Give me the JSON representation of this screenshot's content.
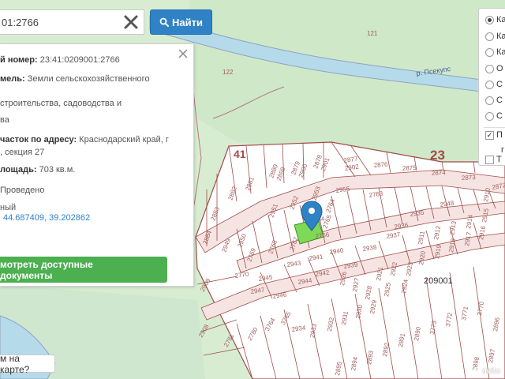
{
  "search": {
    "value": "01:2766",
    "button_label": "Найти",
    "clear_icon": "close-icon",
    "button_icon": "search-icon"
  },
  "info": {
    "lines": [
      {
        "label": "й номер:",
        "value": "23:41:0209001:2766"
      },
      {
        "label": "мель:",
        "value": "Земли сельскохозяйственного"
      },
      {
        "label": "",
        "value": ""
      },
      {
        "label": "",
        "value": "строительства, садоводства и"
      },
      {
        "label": "",
        "value": "ва"
      },
      {
        "label": "",
        "value": ""
      },
      {
        "label": "часток по адресу:",
        "value": "Краснодарский край, г"
      },
      {
        "label": "",
        "value": ", секция 27"
      },
      {
        "label": "",
        "value": ""
      },
      {
        "label": "лощадь:",
        "value": "703 кв.м."
      },
      {
        "label": "",
        "value": ""
      },
      {
        "label": "",
        "value": "Проведено"
      },
      {
        "label": "",
        "value": ""
      },
      {
        "label": "",
        "value": "ный"
      },
      {
        "label": "",
        "value": "44.687409, 39.202862"
      }
    ],
    "docs_button": "мотреть доступные документы"
  },
  "hint": {
    "label": "м на карте?"
  },
  "layers": {
    "items": [
      {
        "label": "Ка",
        "type": "radio",
        "selected": true
      },
      {
        "label": "Ка",
        "type": "radio",
        "selected": false
      },
      {
        "label": "Ка",
        "type": "radio",
        "selected": false
      },
      {
        "label": "О",
        "type": "radio",
        "selected": false
      },
      {
        "label": "С",
        "type": "radio",
        "selected": false
      },
      {
        "label": "С",
        "type": "radio",
        "selected": false
      },
      {
        "label": "С",
        "type": "radio",
        "selected": false
      },
      {
        "label": "П",
        "type": "check",
        "checked": true
      },
      {
        "label": "Т",
        "type": "check",
        "checked": false
      }
    ],
    "sub_label": "г"
  },
  "map": {
    "river_label": "р. Псекупс",
    "quarter_labels": [
      "121",
      "122"
    ],
    "zone_labels": [
      "41",
      "23"
    ],
    "block_label": "209001",
    "plot_numbers": [
      "2880",
      "2879",
      "2878",
      "2877",
      "2876",
      "2875",
      "2874",
      "2873",
      "2872",
      "2881",
      "2882",
      "2883",
      "2884",
      "2955",
      "2763",
      "2764",
      "2765",
      "2766",
      "2767",
      "2768",
      "2769",
      "2770",
      "2949",
      "2950",
      "2951",
      "2952",
      "2953",
      "2954",
      "2948",
      "2947",
      "2946",
      "2945",
      "2944",
      "2943",
      "2942",
      "2941",
      "2940",
      "2939",
      "2938",
      "2937",
      "2936",
      "2935",
      "2934",
      "2933",
      "2932",
      "2931",
      "2930",
      "2929",
      "2928",
      "2927",
      "2926",
      "2925",
      "2924",
      "2923",
      "2922",
      "2921",
      "2920",
      "2919",
      "2918",
      "2917",
      "2916",
      "2915",
      "2914",
      "2913",
      "2912",
      "2911",
      "2910",
      "2909",
      "2908",
      "2781",
      "2780",
      "3764",
      "3765",
      "3770",
      "3771",
      "3772",
      "3773",
      "2890",
      "2891",
      "2892",
      "2893",
      "2894",
      "2895",
      "2896",
      "2897",
      "2898",
      "2899",
      "2900",
      "2901",
      "2902"
    ]
  },
  "watermark": "avito",
  "colors": {
    "accent": "#2f82c5",
    "docs_green": "#4caf50",
    "river": "#b5dbea",
    "parcel_line": "#9e4b47",
    "selected_plot": "#7ed957"
  }
}
